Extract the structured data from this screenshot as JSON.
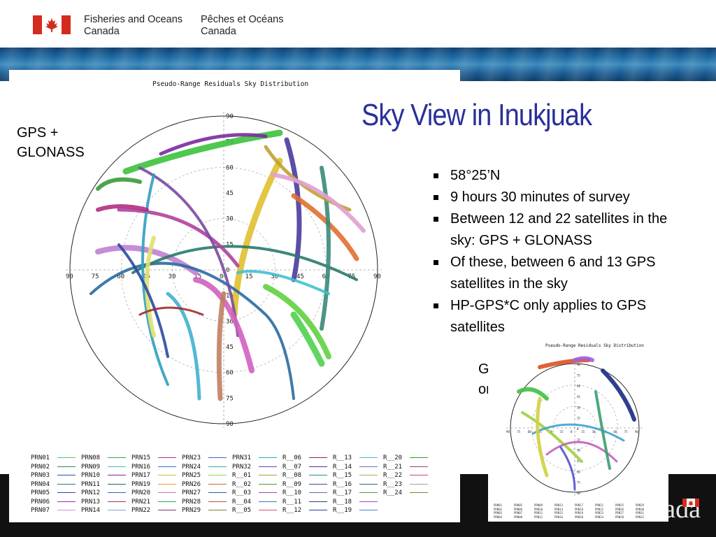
{
  "header": {
    "dept_en_line1": "Fisheries and Oceans",
    "dept_en_line2": "Canada",
    "dept_fr_line1": "Pêches et Océans",
    "dept_fr_line2": "Canada",
    "flag_icon": "canada-flag-icon"
  },
  "footer": {
    "wordmark": "Canada"
  },
  "slide": {
    "title": "Sky View in Inukjuak",
    "gnss_label_line1": "GPS +",
    "gnss_label_line2": "GLONASS",
    "gps_label_line1": "GPS",
    "gps_label_line2": "only",
    "bullets": [
      "58°25’N",
      "9 hours 30 minutes of survey",
      "Between 12 and 22 satellites in the sky: GPS + GLONASS",
      "Of these, between 6 and 13 GPS satellites in the sky",
      "HP-GPS*C only applies to GPS satellites"
    ]
  },
  "chart_data": [
    {
      "type": "scatter",
      "title": "Pseudo-Range Residuals Sky Distribution",
      "projection": "polar sky plot",
      "elevation_ticks": [
        "90",
        "75",
        "60",
        "45",
        "30",
        "15",
        "0",
        "15",
        "30",
        "45",
        "60",
        "75",
        "90"
      ],
      "legend": [
        "PRN01",
        "PRN02",
        "PRN03",
        "PRN04",
        "PRN05",
        "PRN06",
        "PRN07",
        "PRN08",
        "PRN09",
        "PRN10",
        "PRN11",
        "PRN12",
        "PRN13",
        "PRN14",
        "PRN15",
        "PRN16",
        "PRN17",
        "PRN19",
        "PRN20",
        "PRN21",
        "PRN22",
        "PRN23",
        "PRN24",
        "PRN25",
        "PRN26",
        "PRN27",
        "PRN28",
        "PRN29",
        "PRN31",
        "PRN32",
        "R__01",
        "R__02",
        "R__03",
        "R__04",
        "R__05",
        "R__06",
        "R__07",
        "R__08",
        "R__09",
        "R__10",
        "R__11",
        "R__12",
        "R__13",
        "R__14",
        "R__15",
        "R__16",
        "R__17",
        "R__18",
        "R__19",
        "R__20",
        "R__21",
        "R__22",
        "R__23",
        "R__24"
      ],
      "legend_colors": [
        "#5bc46b",
        "#2e8b57",
        "#2d4fb0",
        "#227f77",
        "#3a3ab0",
        "#9b2f9b",
        "#d28ed8",
        "#2fa84a",
        "#44b3d9",
        "#6a2f93",
        "#1f6b52",
        "#3366cc",
        "#a0306a",
        "#7aa6d6",
        "#b03080",
        "#2a7fc0",
        "#c0c040",
        "#e0a030",
        "#d070c0",
        "#2ea060",
        "#7a3a7a",
        "#4060c0",
        "#30b0a0",
        "#a0d040",
        "#c07030",
        "#2a5f8f",
        "#b05050",
        "#808030",
        "#30a0d0",
        "#7040b0",
        "#c09040",
        "#4a9a3a",
        "#9050a0",
        "#3080c0",
        "#d05070",
        "#a02030",
        "#5030a0",
        "#2a8a8a",
        "#3050a0",
        "#6a6aa0",
        "#304080",
        "#2040a0",
        "#40c0d0",
        "#7070c0",
        "#c0a060",
        "#3060a0",
        "#40a040",
        "#b040b0",
        "#5a7ad0",
        "#30a020",
        "#a04060",
        "#c05050",
        "#a0a0a0",
        "#609030"
      ]
    },
    {
      "type": "scatter",
      "title": "Pseudo-Range Residuals Sky Distribution",
      "projection": "polar sky plot",
      "elevation_ticks": [
        "90",
        "75",
        "60",
        "45",
        "30",
        "15",
        "0",
        "15",
        "30",
        "45",
        "60",
        "75",
        "90"
      ],
      "legend": [
        "PRN01",
        "PRN02",
        "PRN03",
        "PRN04",
        "PRN05",
        "PRN06",
        "PRN07",
        "PRN08",
        "PRN09",
        "PRN10",
        "PRN11",
        "PRN12",
        "PRN13",
        "PRN14",
        "PRN15",
        "PRN16",
        "PRN17",
        "PRN18",
        "PRN19",
        "PRN20",
        "PRN21",
        "PRN22",
        "PRN23",
        "PRN24",
        "PRN25",
        "PRN26",
        "PRN27",
        "PRN28",
        "PRN29",
        "PRN30",
        "PRN31",
        "PRN32"
      ]
    }
  ]
}
